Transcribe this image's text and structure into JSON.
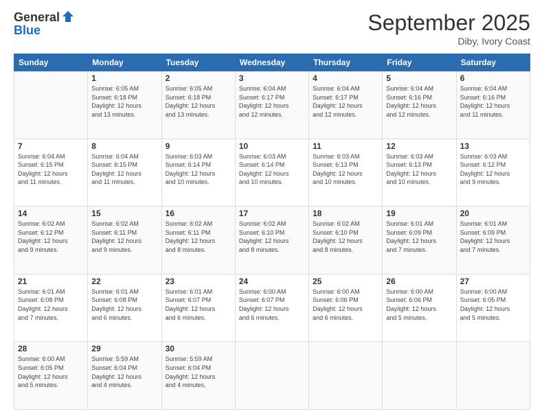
{
  "header": {
    "logo_line1": "General",
    "logo_line2": "Blue",
    "month_title": "September 2025",
    "location": "Diby, Ivory Coast"
  },
  "calendar": {
    "days_of_week": [
      "Sunday",
      "Monday",
      "Tuesday",
      "Wednesday",
      "Thursday",
      "Friday",
      "Saturday"
    ],
    "weeks": [
      [
        {
          "day": "",
          "info": ""
        },
        {
          "day": "1",
          "info": "Sunrise: 6:05 AM\nSunset: 6:18 PM\nDaylight: 12 hours\nand 13 minutes."
        },
        {
          "day": "2",
          "info": "Sunrise: 6:05 AM\nSunset: 6:18 PM\nDaylight: 12 hours\nand 13 minutes."
        },
        {
          "day": "3",
          "info": "Sunrise: 6:04 AM\nSunset: 6:17 PM\nDaylight: 12 hours\nand 12 minutes."
        },
        {
          "day": "4",
          "info": "Sunrise: 6:04 AM\nSunset: 6:17 PM\nDaylight: 12 hours\nand 12 minutes."
        },
        {
          "day": "5",
          "info": "Sunrise: 6:04 AM\nSunset: 6:16 PM\nDaylight: 12 hours\nand 12 minutes."
        },
        {
          "day": "6",
          "info": "Sunrise: 6:04 AM\nSunset: 6:16 PM\nDaylight: 12 hours\nand 11 minutes."
        }
      ],
      [
        {
          "day": "7",
          "info": "Sunrise: 6:04 AM\nSunset: 6:15 PM\nDaylight: 12 hours\nand 11 minutes."
        },
        {
          "day": "8",
          "info": "Sunrise: 6:04 AM\nSunset: 6:15 PM\nDaylight: 12 hours\nand 11 minutes."
        },
        {
          "day": "9",
          "info": "Sunrise: 6:03 AM\nSunset: 6:14 PM\nDaylight: 12 hours\nand 10 minutes."
        },
        {
          "day": "10",
          "info": "Sunrise: 6:03 AM\nSunset: 6:14 PM\nDaylight: 12 hours\nand 10 minutes."
        },
        {
          "day": "11",
          "info": "Sunrise: 6:03 AM\nSunset: 6:13 PM\nDaylight: 12 hours\nand 10 minutes."
        },
        {
          "day": "12",
          "info": "Sunrise: 6:03 AM\nSunset: 6:13 PM\nDaylight: 12 hours\nand 10 minutes."
        },
        {
          "day": "13",
          "info": "Sunrise: 6:03 AM\nSunset: 6:12 PM\nDaylight: 12 hours\nand 9 minutes."
        }
      ],
      [
        {
          "day": "14",
          "info": "Sunrise: 6:02 AM\nSunset: 6:12 PM\nDaylight: 12 hours\nand 9 minutes."
        },
        {
          "day": "15",
          "info": "Sunrise: 6:02 AM\nSunset: 6:11 PM\nDaylight: 12 hours\nand 9 minutes."
        },
        {
          "day": "16",
          "info": "Sunrise: 6:02 AM\nSunset: 6:11 PM\nDaylight: 12 hours\nand 8 minutes."
        },
        {
          "day": "17",
          "info": "Sunrise: 6:02 AM\nSunset: 6:10 PM\nDaylight: 12 hours\nand 8 minutes."
        },
        {
          "day": "18",
          "info": "Sunrise: 6:02 AM\nSunset: 6:10 PM\nDaylight: 12 hours\nand 8 minutes."
        },
        {
          "day": "19",
          "info": "Sunrise: 6:01 AM\nSunset: 6:09 PM\nDaylight: 12 hours\nand 7 minutes."
        },
        {
          "day": "20",
          "info": "Sunrise: 6:01 AM\nSunset: 6:09 PM\nDaylight: 12 hours\nand 7 minutes."
        }
      ],
      [
        {
          "day": "21",
          "info": "Sunrise: 6:01 AM\nSunset: 6:08 PM\nDaylight: 12 hours\nand 7 minutes."
        },
        {
          "day": "22",
          "info": "Sunrise: 6:01 AM\nSunset: 6:08 PM\nDaylight: 12 hours\nand 6 minutes."
        },
        {
          "day": "23",
          "info": "Sunrise: 6:01 AM\nSunset: 6:07 PM\nDaylight: 12 hours\nand 6 minutes."
        },
        {
          "day": "24",
          "info": "Sunrise: 6:00 AM\nSunset: 6:07 PM\nDaylight: 12 hours\nand 6 minutes."
        },
        {
          "day": "25",
          "info": "Sunrise: 6:00 AM\nSunset: 6:06 PM\nDaylight: 12 hours\nand 6 minutes."
        },
        {
          "day": "26",
          "info": "Sunrise: 6:00 AM\nSunset: 6:06 PM\nDaylight: 12 hours\nand 5 minutes."
        },
        {
          "day": "27",
          "info": "Sunrise: 6:00 AM\nSunset: 6:05 PM\nDaylight: 12 hours\nand 5 minutes."
        }
      ],
      [
        {
          "day": "28",
          "info": "Sunrise: 6:00 AM\nSunset: 6:05 PM\nDaylight: 12 hours\nand 5 minutes."
        },
        {
          "day": "29",
          "info": "Sunrise: 5:59 AM\nSunset: 6:04 PM\nDaylight: 12 hours\nand 4 minutes."
        },
        {
          "day": "30",
          "info": "Sunrise: 5:59 AM\nSunset: 6:04 PM\nDaylight: 12 hours\nand 4 minutes."
        },
        {
          "day": "",
          "info": ""
        },
        {
          "day": "",
          "info": ""
        },
        {
          "day": "",
          "info": ""
        },
        {
          "day": "",
          "info": ""
        }
      ]
    ]
  }
}
